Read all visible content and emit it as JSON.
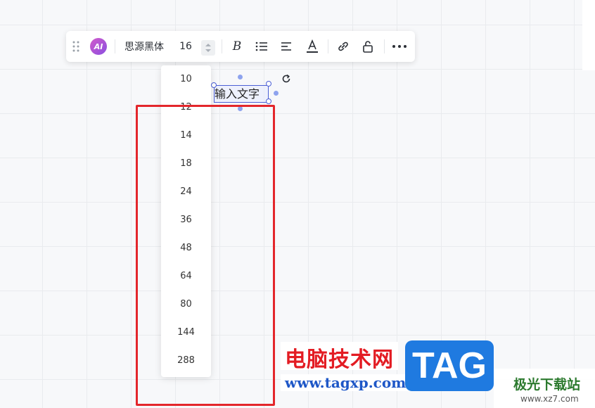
{
  "toolbar": {
    "ai_label": "AI",
    "font_name": "思源黑体",
    "font_size": "16",
    "bold_label": "B"
  },
  "font_size_dropdown": {
    "options": [
      "10",
      "12",
      "14",
      "18",
      "24",
      "36",
      "48",
      "64",
      "80",
      "144",
      "288"
    ]
  },
  "canvas": {
    "text_element": "输入文字"
  },
  "watermark": {
    "site_cn": "电脑技术网",
    "url": "www.tagxp.com",
    "logo": "TAG",
    "site2": "极光下载站",
    "site2_url": "www.xz7.com"
  },
  "colors": {
    "highlight": "#e3262b",
    "selection": "#4b5fd6",
    "ai_badge": "#b656d3"
  },
  "icons": [
    "drag-handle-icon",
    "chevron-up-icon",
    "chevron-down-icon",
    "bullet-list-icon",
    "align-left-icon",
    "font-color-icon",
    "link-icon",
    "unlock-icon",
    "more-icon",
    "rotate-icon"
  ]
}
